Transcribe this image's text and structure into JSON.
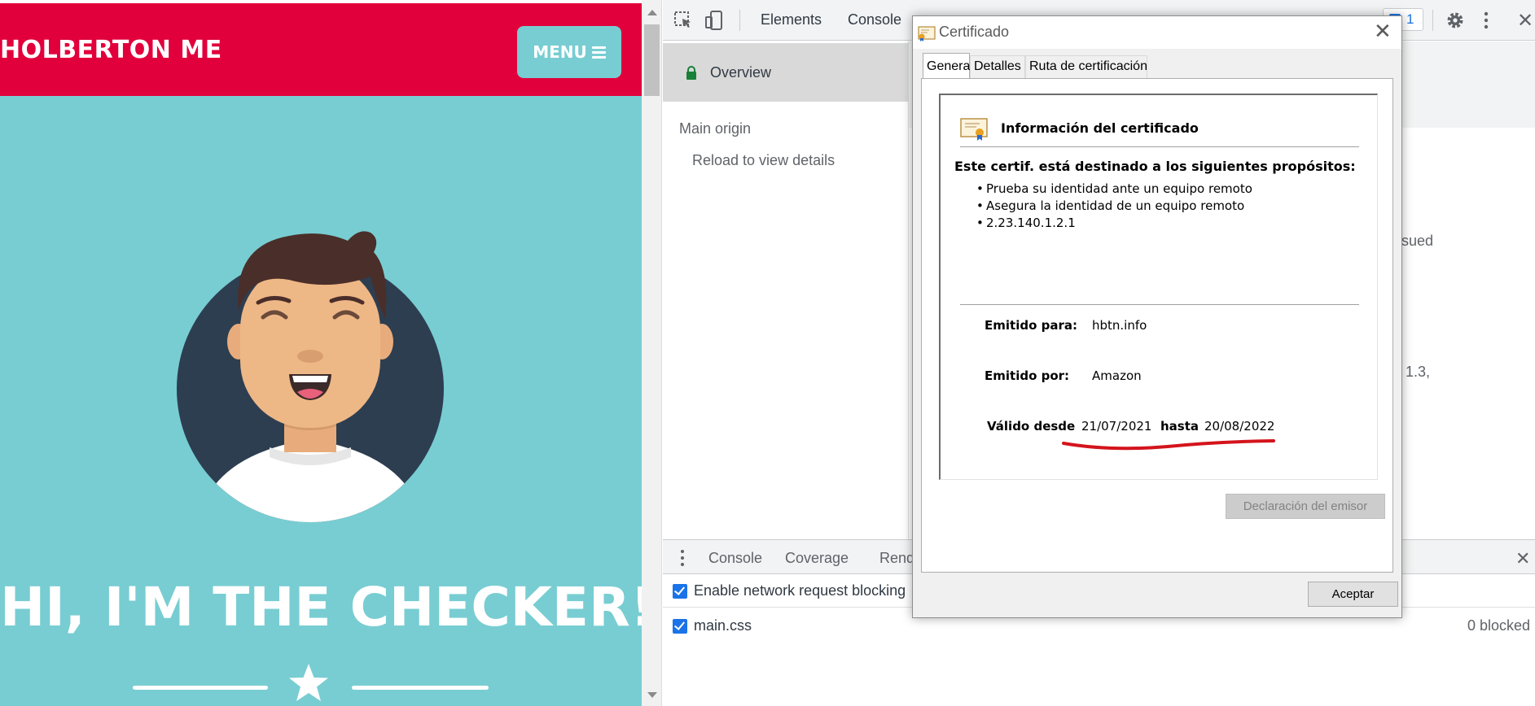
{
  "site": {
    "title": "HOLBERTON ME",
    "menu_label": "MENU",
    "hero_title": "HI, I'M THE CHECKER!",
    "colors": {
      "header": "#e1003c",
      "background": "#78cdd2",
      "avatar_circle": "#2d3e50"
    },
    "icons": [
      "hamburger-icon",
      "star-icon"
    ]
  },
  "devtools": {
    "tabs": [
      "Elements",
      "Console"
    ],
    "badge_count": "1",
    "security": {
      "overview_label": "Overview",
      "main_origin_label": "Main origin",
      "reload_label": "Reload to view details",
      "partial_texts": [
        "ssued",
        "1.3,"
      ]
    },
    "drawer": {
      "tabs": [
        "Console",
        "Coverage",
        "Rend"
      ],
      "enable_blocking_label": "Enable network request blocking",
      "rule": "main.css",
      "blocked_count": "0 blocked"
    }
  },
  "dialog": {
    "title": "Certificado",
    "tabs": [
      "General",
      "Detalles",
      "Ruta de certificación"
    ],
    "info_heading": "Información del certificado",
    "purpose_heading": "Este certif. está destinado a los siguientes propósitos:",
    "purposes": [
      "Prueba su identidad ante un equipo remoto",
      "Asegura la identidad de un equipo remoto",
      "2.23.140.1.2.1"
    ],
    "issued_to_label": "Emitido para:",
    "issued_to": "hbtn.info",
    "issued_by_label": "Emitido por:",
    "issued_by": "Amazon",
    "valid_from_label": "Válido desde",
    "valid_from": "21/07/2021",
    "valid_to_label": "hasta",
    "valid_to": "20/08/2022",
    "issuer_statement_button": "Declaración del emisor",
    "ok_button": "Aceptar",
    "annotation_color": "#d4141c"
  }
}
